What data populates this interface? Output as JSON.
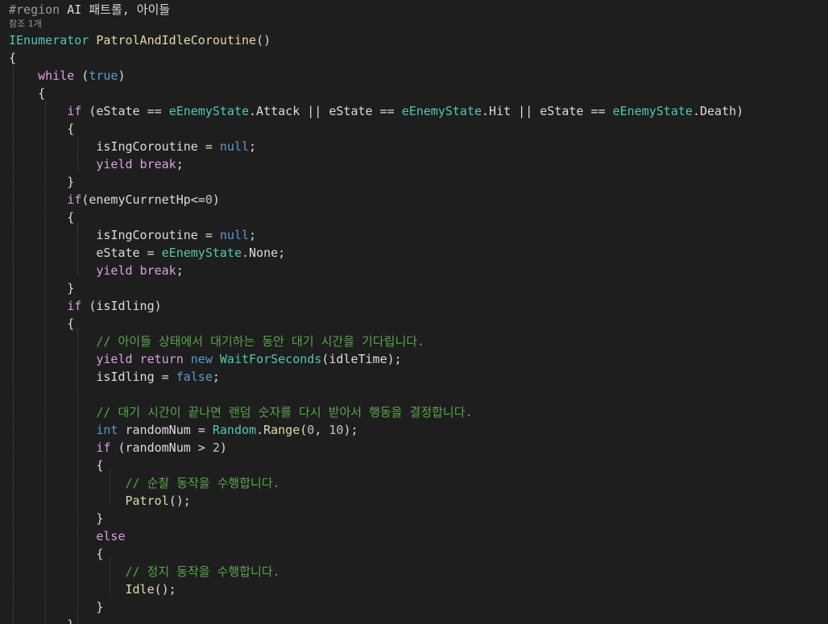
{
  "editor": {
    "codelens": "참조 1개",
    "lines": [
      [
        {
          "t": "#region ",
          "c": "pp"
        },
        {
          "t": "AI 패트롤, 아이들",
          "c": "p"
        }
      ],
      null,
      [
        {
          "t": "IEnumerator ",
          "c": "t"
        },
        {
          "t": "PatrolAndIdleCoroutine",
          "c": "f"
        },
        {
          "t": "()",
          "c": "p"
        }
      ],
      [
        {
          "t": "{",
          "c": "p"
        }
      ],
      [
        {
          "t": "    "
        },
        {
          "t": "while",
          "c": "c"
        },
        {
          "t": " (",
          "c": "p"
        },
        {
          "t": "true",
          "c": "k"
        },
        {
          "t": ")",
          "c": "p"
        }
      ],
      [
        {
          "t": "    "
        },
        {
          "t": "{",
          "c": "p"
        }
      ],
      [
        {
          "t": "        "
        },
        {
          "t": "if",
          "c": "c"
        },
        {
          "t": " (eState == ",
          "c": "p"
        },
        {
          "t": "eEnemyState",
          "c": "t"
        },
        {
          "t": ".Attack || eState == ",
          "c": "p"
        },
        {
          "t": "eEnemyState",
          "c": "t"
        },
        {
          "t": ".Hit || eState == ",
          "c": "p"
        },
        {
          "t": "eEnemyState",
          "c": "t"
        },
        {
          "t": ".Death)",
          "c": "p"
        }
      ],
      [
        {
          "t": "        "
        },
        {
          "t": "{",
          "c": "p"
        }
      ],
      [
        {
          "t": "            "
        },
        {
          "t": "isIngCoroutine = ",
          "c": "p"
        },
        {
          "t": "null",
          "c": "k"
        },
        {
          "t": ";",
          "c": "p"
        }
      ],
      [
        {
          "t": "            "
        },
        {
          "t": "yield break",
          "c": "c"
        },
        {
          "t": ";",
          "c": "p"
        }
      ],
      [
        {
          "t": "        "
        },
        {
          "t": "}",
          "c": "p"
        }
      ],
      [
        {
          "t": "        "
        },
        {
          "t": "if",
          "c": "c"
        },
        {
          "t": "(enemyCurrnetHp<=",
          "c": "p"
        },
        {
          "t": "0",
          "c": "n"
        },
        {
          "t": ")",
          "c": "p"
        }
      ],
      [
        {
          "t": "        "
        },
        {
          "t": "{",
          "c": "p"
        }
      ],
      [
        {
          "t": "            "
        },
        {
          "t": "isIngCoroutine = ",
          "c": "p"
        },
        {
          "t": "null",
          "c": "k"
        },
        {
          "t": ";",
          "c": "p"
        }
      ],
      [
        {
          "t": "            "
        },
        {
          "t": "eState = ",
          "c": "p"
        },
        {
          "t": "eEnemyState",
          "c": "t"
        },
        {
          "t": ".None;",
          "c": "p"
        }
      ],
      [
        {
          "t": "            "
        },
        {
          "t": "yield break",
          "c": "c"
        },
        {
          "t": ";",
          "c": "p"
        }
      ],
      [
        {
          "t": "        "
        },
        {
          "t": "}",
          "c": "p"
        }
      ],
      [
        {
          "t": "        "
        },
        {
          "t": "if",
          "c": "c"
        },
        {
          "t": " (isIdling)",
          "c": "p"
        }
      ],
      [
        {
          "t": "        "
        },
        {
          "t": "{",
          "c": "p"
        }
      ],
      [
        {
          "t": "            "
        },
        {
          "t": "// 아이들 상태에서 대기하는 동안 대기 시간을 기다립니다.",
          "c": "cm"
        }
      ],
      [
        {
          "t": "            "
        },
        {
          "t": "yield return ",
          "c": "c"
        },
        {
          "t": "new ",
          "c": "k"
        },
        {
          "t": "WaitForSeconds",
          "c": "t"
        },
        {
          "t": "(idleTime);",
          "c": "p"
        }
      ],
      [
        {
          "t": "            "
        },
        {
          "t": "isIdling = ",
          "c": "p"
        },
        {
          "t": "false",
          "c": "k"
        },
        {
          "t": ";",
          "c": "p"
        }
      ],
      [],
      [
        {
          "t": "            "
        },
        {
          "t": "// 대기 시간이 끝나면 랜덤 숫자를 다시 받아서 행동을 결정합니다.",
          "c": "cm"
        }
      ],
      [
        {
          "t": "            "
        },
        {
          "t": "int ",
          "c": "k"
        },
        {
          "t": "randomNum = ",
          "c": "p"
        },
        {
          "t": "Random",
          "c": "t"
        },
        {
          "t": ".",
          "c": "p"
        },
        {
          "t": "Range",
          "c": "f"
        },
        {
          "t": "(",
          "c": "p"
        },
        {
          "t": "0",
          "c": "n"
        },
        {
          "t": ", ",
          "c": "p"
        },
        {
          "t": "10",
          "c": "n"
        },
        {
          "t": ");",
          "c": "p"
        }
      ],
      [
        {
          "t": "            "
        },
        {
          "t": "if",
          "c": "c"
        },
        {
          "t": " (randomNum > ",
          "c": "p"
        },
        {
          "t": "2",
          "c": "n"
        },
        {
          "t": ")",
          "c": "p"
        }
      ],
      [
        {
          "t": "            "
        },
        {
          "t": "{",
          "c": "p"
        }
      ],
      [
        {
          "t": "                "
        },
        {
          "t": "// 순찰 동작을 수행합니다.",
          "c": "cm"
        }
      ],
      [
        {
          "t": "                "
        },
        {
          "t": "Patrol",
          "c": "f"
        },
        {
          "t": "();",
          "c": "p"
        }
      ],
      [
        {
          "t": "            "
        },
        {
          "t": "}",
          "c": "p"
        }
      ],
      [
        {
          "t": "            "
        },
        {
          "t": "else",
          "c": "c"
        }
      ],
      [
        {
          "t": "            "
        },
        {
          "t": "{",
          "c": "p"
        }
      ],
      [
        {
          "t": "                "
        },
        {
          "t": "// 정지 동작을 수행합니다.",
          "c": "cm"
        }
      ],
      [
        {
          "t": "                "
        },
        {
          "t": "Idle",
          "c": "f"
        },
        {
          "t": "();",
          "c": "p"
        }
      ],
      [
        {
          "t": "            "
        },
        {
          "t": "}",
          "c": "p"
        }
      ],
      [
        {
          "t": "        "
        },
        {
          "t": "}",
          "c": "p"
        }
      ]
    ]
  }
}
